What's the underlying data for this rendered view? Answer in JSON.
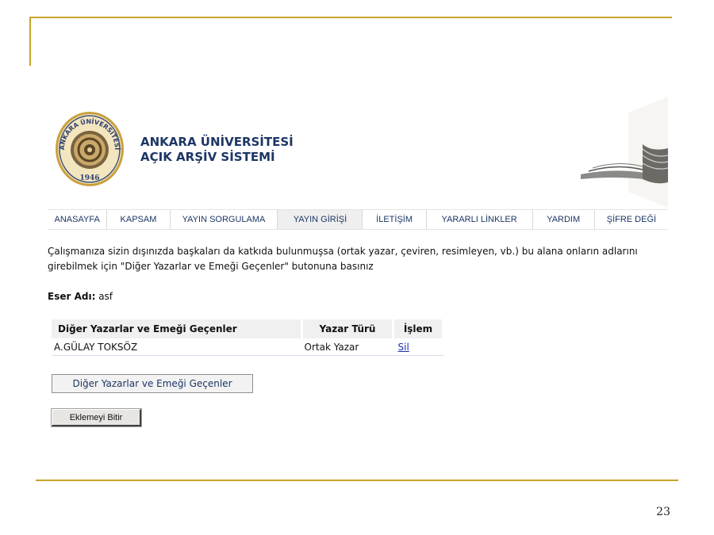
{
  "slide": {
    "page_number": "23"
  },
  "header": {
    "university_line1": "ANKARA ÜNİVERSİTESİ",
    "university_line2": "AÇIK ARŞİV SİSTEMİ",
    "logo": {
      "ring_text": "ANKARA ÜNİVERSİTESİ",
      "year": "1946"
    },
    "colors": {
      "title": "#1d3664",
      "frame": "#c8a42a"
    }
  },
  "nav": {
    "items": [
      {
        "label": "ANASAYFA"
      },
      {
        "label": "KAPSAM"
      },
      {
        "label": "YAYIN SORGULAMA"
      },
      {
        "label": "YAYIN GİRİŞİ",
        "active": true
      },
      {
        "label": "İLETİŞİM"
      },
      {
        "label": "YARARLI LİNKLER"
      },
      {
        "label": "YARDIM"
      },
      {
        "label": "ŞİFRE DEĞİ"
      }
    ]
  },
  "content": {
    "instructions_line1": "Çalışmanıza sizin dışınızda başkaları da katkıda bulunmuşsa (ortak yazar, çeviren, resimleyen, vb.) bu alana onların adlarını",
    "instructions_line2": "girebilmek için \"Diğer Yazarlar ve Emeği Geçenler\" butonuna basınız",
    "work_name_label": "Eser Adı:",
    "work_name_value": "asf"
  },
  "table": {
    "headers": [
      "Diğer Yazarlar ve Emeği Geçenler",
      "Yazar Türü",
      "İşlem"
    ],
    "rows": [
      {
        "name": "A.GÜLAY TOKSÖZ",
        "type": "Ortak Yazar",
        "action": "Sil"
      }
    ]
  },
  "buttons": {
    "add_contributors": "Diğer Yazarlar ve Emeği Geçenler",
    "finish": "Eklemeyi Bitir"
  }
}
